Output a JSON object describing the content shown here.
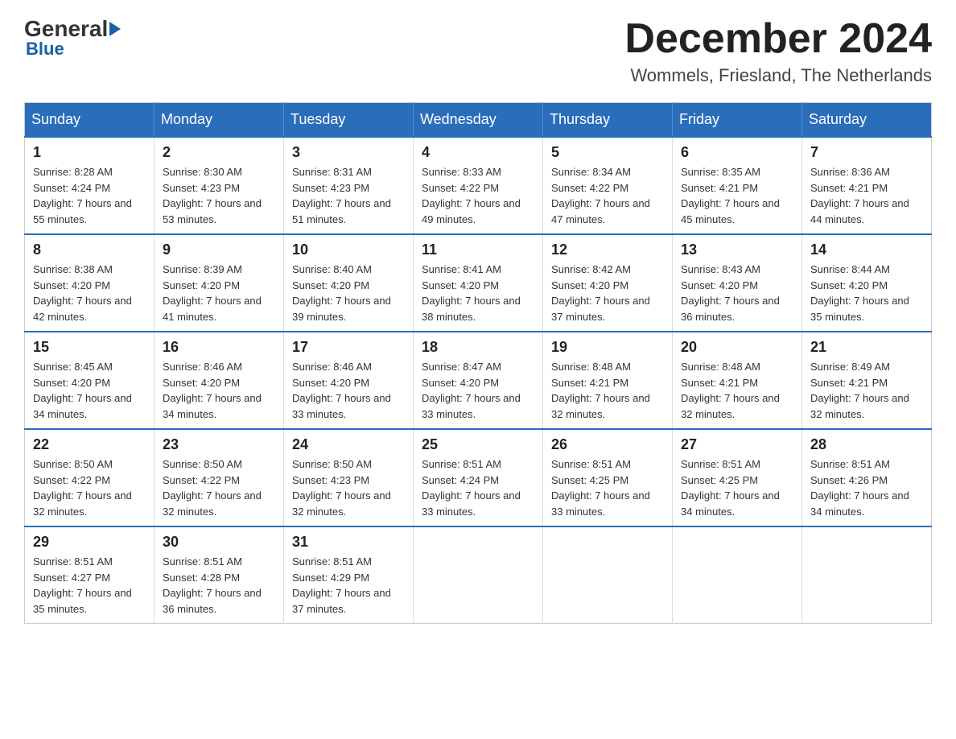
{
  "logo": {
    "general": "General",
    "blue": "Blue"
  },
  "header": {
    "month": "December 2024",
    "location": "Wommels, Friesland, The Netherlands"
  },
  "weekdays": [
    "Sunday",
    "Monday",
    "Tuesday",
    "Wednesday",
    "Thursday",
    "Friday",
    "Saturday"
  ],
  "weeks": [
    [
      {
        "day": "1",
        "sunrise": "8:28 AM",
        "sunset": "4:24 PM",
        "daylight": "7 hours and 55 minutes."
      },
      {
        "day": "2",
        "sunrise": "8:30 AM",
        "sunset": "4:23 PM",
        "daylight": "7 hours and 53 minutes."
      },
      {
        "day": "3",
        "sunrise": "8:31 AM",
        "sunset": "4:23 PM",
        "daylight": "7 hours and 51 minutes."
      },
      {
        "day": "4",
        "sunrise": "8:33 AM",
        "sunset": "4:22 PM",
        "daylight": "7 hours and 49 minutes."
      },
      {
        "day": "5",
        "sunrise": "8:34 AM",
        "sunset": "4:22 PM",
        "daylight": "7 hours and 47 minutes."
      },
      {
        "day": "6",
        "sunrise": "8:35 AM",
        "sunset": "4:21 PM",
        "daylight": "7 hours and 45 minutes."
      },
      {
        "day": "7",
        "sunrise": "8:36 AM",
        "sunset": "4:21 PM",
        "daylight": "7 hours and 44 minutes."
      }
    ],
    [
      {
        "day": "8",
        "sunrise": "8:38 AM",
        "sunset": "4:20 PM",
        "daylight": "7 hours and 42 minutes."
      },
      {
        "day": "9",
        "sunrise": "8:39 AM",
        "sunset": "4:20 PM",
        "daylight": "7 hours and 41 minutes."
      },
      {
        "day": "10",
        "sunrise": "8:40 AM",
        "sunset": "4:20 PM",
        "daylight": "7 hours and 39 minutes."
      },
      {
        "day": "11",
        "sunrise": "8:41 AM",
        "sunset": "4:20 PM",
        "daylight": "7 hours and 38 minutes."
      },
      {
        "day": "12",
        "sunrise": "8:42 AM",
        "sunset": "4:20 PM",
        "daylight": "7 hours and 37 minutes."
      },
      {
        "day": "13",
        "sunrise": "8:43 AM",
        "sunset": "4:20 PM",
        "daylight": "7 hours and 36 minutes."
      },
      {
        "day": "14",
        "sunrise": "8:44 AM",
        "sunset": "4:20 PM",
        "daylight": "7 hours and 35 minutes."
      }
    ],
    [
      {
        "day": "15",
        "sunrise": "8:45 AM",
        "sunset": "4:20 PM",
        "daylight": "7 hours and 34 minutes."
      },
      {
        "day": "16",
        "sunrise": "8:46 AM",
        "sunset": "4:20 PM",
        "daylight": "7 hours and 34 minutes."
      },
      {
        "day": "17",
        "sunrise": "8:46 AM",
        "sunset": "4:20 PM",
        "daylight": "7 hours and 33 minutes."
      },
      {
        "day": "18",
        "sunrise": "8:47 AM",
        "sunset": "4:20 PM",
        "daylight": "7 hours and 33 minutes."
      },
      {
        "day": "19",
        "sunrise": "8:48 AM",
        "sunset": "4:21 PM",
        "daylight": "7 hours and 32 minutes."
      },
      {
        "day": "20",
        "sunrise": "8:48 AM",
        "sunset": "4:21 PM",
        "daylight": "7 hours and 32 minutes."
      },
      {
        "day": "21",
        "sunrise": "8:49 AM",
        "sunset": "4:21 PM",
        "daylight": "7 hours and 32 minutes."
      }
    ],
    [
      {
        "day": "22",
        "sunrise": "8:50 AM",
        "sunset": "4:22 PM",
        "daylight": "7 hours and 32 minutes."
      },
      {
        "day": "23",
        "sunrise": "8:50 AM",
        "sunset": "4:22 PM",
        "daylight": "7 hours and 32 minutes."
      },
      {
        "day": "24",
        "sunrise": "8:50 AM",
        "sunset": "4:23 PM",
        "daylight": "7 hours and 32 minutes."
      },
      {
        "day": "25",
        "sunrise": "8:51 AM",
        "sunset": "4:24 PM",
        "daylight": "7 hours and 33 minutes."
      },
      {
        "day": "26",
        "sunrise": "8:51 AM",
        "sunset": "4:25 PM",
        "daylight": "7 hours and 33 minutes."
      },
      {
        "day": "27",
        "sunrise": "8:51 AM",
        "sunset": "4:25 PM",
        "daylight": "7 hours and 34 minutes."
      },
      {
        "day": "28",
        "sunrise": "8:51 AM",
        "sunset": "4:26 PM",
        "daylight": "7 hours and 34 minutes."
      }
    ],
    [
      {
        "day": "29",
        "sunrise": "8:51 AM",
        "sunset": "4:27 PM",
        "daylight": "7 hours and 35 minutes."
      },
      {
        "day": "30",
        "sunrise": "8:51 AM",
        "sunset": "4:28 PM",
        "daylight": "7 hours and 36 minutes."
      },
      {
        "day": "31",
        "sunrise": "8:51 AM",
        "sunset": "4:29 PM",
        "daylight": "7 hours and 37 minutes."
      },
      null,
      null,
      null,
      null
    ]
  ]
}
